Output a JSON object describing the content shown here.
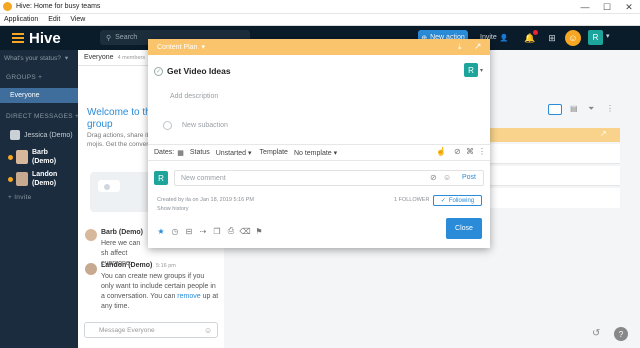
{
  "window": {
    "title": "Hive: Home for busy teams",
    "controls": [
      "—",
      "☐",
      "✕"
    ]
  },
  "menubar": [
    "Application",
    "Edit",
    "View"
  ],
  "header": {
    "brand": "Hive",
    "search_placeholder": "Search",
    "new_action": "New action",
    "invite": "Invite",
    "avatar_letter": "R",
    "brand_color": "#f5a623"
  },
  "sidebar": {
    "status_placeholder": "What's your status?",
    "groups_label": "GROUPS +",
    "everyone": "Everyone",
    "dm_label": "DIRECT MESSAGES +",
    "dms": [
      {
        "name": "Jessica (Demo)"
      },
      {
        "name": "Barb\n(Demo)"
      },
      {
        "name": "Landon\n(Demo)"
      }
    ],
    "invite": "+ Invite"
  },
  "channel": {
    "name": "Everyone",
    "members": "4 members"
  },
  "chat": {
    "welcome": "Welcome to the group",
    "welcome_sub": "Drag actions, share it, mojis. Get the conver",
    "messages": [
      {
        "name": "Barb (Demo)",
        "text": "Here we can sh affect everyone."
      },
      {
        "name": "Landon (Demo)",
        "time": "5:16 pm",
        "text": "You can create new groups if you only want to include certain people in a conversation. You can",
        "link": "remove",
        "tail": "up at any time."
      }
    ],
    "input_placeholder": "Message Everyone"
  },
  "modal": {
    "project": "Content Plan",
    "task_title": "Get Video Ideas",
    "assignee": "R",
    "description_placeholder": "Add description",
    "subaction_placeholder": "New subaction",
    "dates_label": "Dates:",
    "status_label": "Status",
    "status_value": "Unstarted",
    "template_label": "Template",
    "template_value": "No template",
    "comment_placeholder": "New comment",
    "post": "Post",
    "created_by": "Created by ila on Jan 18, 2019 5:16 PM",
    "show_history": "Show history",
    "follower_count": "1 FOLLOWER",
    "following": "Following",
    "close": "Close",
    "accent": "#f9c46b",
    "primary": "#2a8cd8"
  }
}
